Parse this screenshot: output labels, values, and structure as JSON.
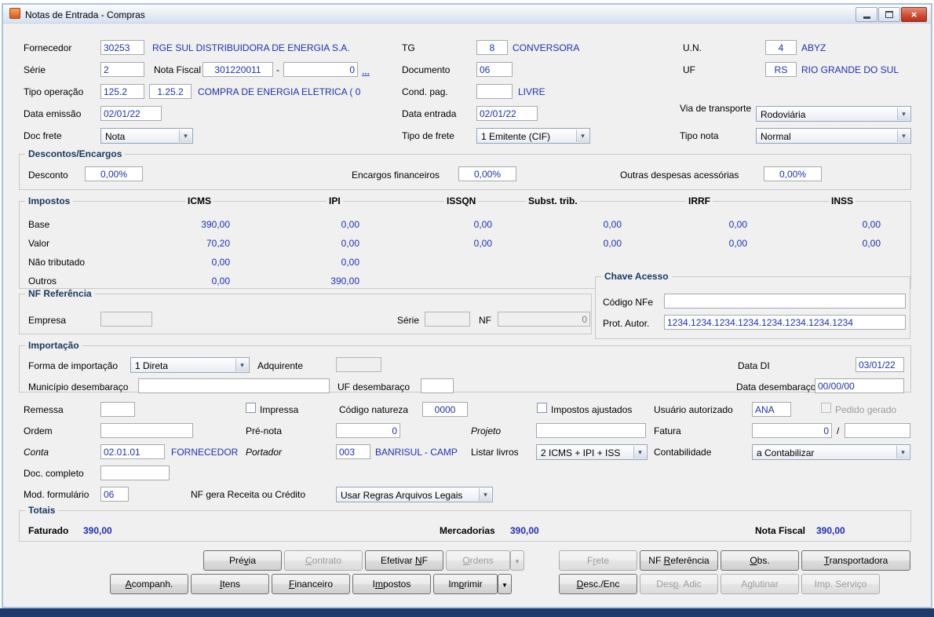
{
  "window": {
    "title": "Notas de Entrada - Compras"
  },
  "icons": {
    "combo_arrow": "▾",
    "dropdown_arrow": "▼",
    "close": "×"
  },
  "fields": {
    "fornecedor": {
      "label": "Fornecedor",
      "code": "30253",
      "desc": "RGE SUL DISTRIBUIDORA DE ENERGIA S.A."
    },
    "tg": {
      "label": "TG",
      "code": "8",
      "desc": "CONVERSORA"
    },
    "un": {
      "label": "U.N.",
      "code": "4",
      "desc": "ABYZ"
    },
    "serie": {
      "label": "Série",
      "value": "2"
    },
    "nota_fiscal": {
      "label": "Nota Fiscal",
      "numero": "301220011",
      "dash": "-",
      "serie_sufixo": "0",
      "browse": "..."
    },
    "documento": {
      "label": "Documento",
      "value": "06"
    },
    "uf": {
      "label": "UF",
      "code": "RS",
      "desc": "RIO GRANDE DO SUL"
    },
    "tipo_operacao": {
      "label": "Tipo operação",
      "code": "125.2",
      "natureza": "1.25.2",
      "desc": "COMPRA DE ENERGIA ELETRICA ( 0"
    },
    "cond_pag": {
      "label": "Cond. pag.",
      "value": "",
      "desc": "LIVRE"
    },
    "data_emissao": {
      "label": "Data emissão",
      "value": "02/01/22"
    },
    "data_entrada": {
      "label": "Data entrada",
      "value": "02/01/22"
    },
    "via_transporte": {
      "label": "Via de transporte",
      "value": "Rodoviária"
    },
    "doc_frete": {
      "label": "Doc frete",
      "value": "Nota"
    },
    "tipo_frete": {
      "label": "Tipo de frete",
      "value": "1 Emitente (CIF)"
    },
    "tipo_nota": {
      "label": "Tipo nota",
      "value": "Normal"
    }
  },
  "descontos_encargos": {
    "title": "Descontos/Encargos",
    "desconto": {
      "label": "Desconto",
      "value": "0,00%"
    },
    "encargos_financeiros": {
      "label": "Encargos financeiros",
      "value": "0,00%"
    },
    "outras_despesas": {
      "label": "Outras despesas acessórias",
      "value": "0,00%"
    }
  },
  "impostos": {
    "title": "Impostos",
    "columns": [
      "ICMS",
      "IPI",
      "ISSQN",
      "Subst. trib.",
      "IRRF",
      "INSS"
    ],
    "rows": [
      {
        "label": "Base",
        "values": [
          "390,00",
          "0,00",
          "0,00",
          "0,00",
          "0,00",
          "0,00"
        ]
      },
      {
        "label": "Valor",
        "values": [
          "70,20",
          "0,00",
          "0,00",
          "0,00",
          "0,00",
          "0,00"
        ]
      },
      {
        "label": "Não tributado",
        "values": [
          "0,00",
          "0,00",
          "",
          "",
          "",
          ""
        ]
      },
      {
        "label": "Outros",
        "values": [
          "0,00",
          "390,00",
          "",
          "",
          "",
          ""
        ]
      }
    ]
  },
  "nf_referencia": {
    "title": "NF Referência",
    "empresa": {
      "label": "Empresa",
      "value": ""
    },
    "serie": {
      "label": "Série",
      "value": ""
    },
    "nf": {
      "label": "NF",
      "value": "0"
    }
  },
  "chave_acesso": {
    "title": "Chave Acesso",
    "codigo_nfe": {
      "label": "Código NFe",
      "value": ""
    },
    "prot_autor": {
      "label": "Prot. Autor.",
      "value": "1234.1234.1234.1234.1234.1234.1234.1234"
    }
  },
  "importacao": {
    "title": "Importação",
    "forma": {
      "label": "Forma de importação",
      "value": "1 Direta"
    },
    "adquirente": {
      "label": "Adquirente",
      "value": ""
    },
    "data_di": {
      "label": "Data DI",
      "value": "03/01/22"
    },
    "municipio": {
      "label": "Município desembaraço",
      "value": ""
    },
    "uf_desembaraco": {
      "label": "UF desembaraço",
      "value": ""
    },
    "data_desembaraco": {
      "label": "Data desembaraço",
      "value": "00/00/00"
    }
  },
  "outros_campos": {
    "remessa": {
      "label": "Remessa",
      "value": ""
    },
    "impressa": {
      "label": "Impressa",
      "checked": false
    },
    "codigo_natureza": {
      "label": "Código natureza",
      "value": "0000"
    },
    "impostos_ajustados": {
      "label": "Impostos ajustados",
      "checked": false
    },
    "usuario_autorizado": {
      "label": "Usuário autorizado",
      "value": "ANA"
    },
    "pedido_gerado": {
      "label": "Pedido gerado",
      "checked": false
    },
    "ordem": {
      "label": "Ordem",
      "value": ""
    },
    "pre_nota": {
      "label": "Pré-nota",
      "value": "0"
    },
    "projeto": {
      "label": "Projeto",
      "value": ""
    },
    "fatura": {
      "label": "Fatura",
      "value": "0",
      "separator": "/",
      "value2": ""
    },
    "conta": {
      "label": "Conta",
      "value": "02.01.01",
      "desc": "FORNECEDOR"
    },
    "portador": {
      "label": "Portador",
      "value": "003",
      "desc": "BANRISUL - CAMP"
    },
    "listar_livros": {
      "label": "Listar livros",
      "value": "2 ICMS + IPI + ISS"
    },
    "contabilidade": {
      "label": "Contabilidade",
      "value": "a Contabilizar"
    },
    "doc_completo": {
      "label": "Doc. completo",
      "value": ""
    },
    "mod_formulario": {
      "label": "Mod. formulário",
      "value": "06"
    },
    "nf_gera": {
      "label": "NF gera Receita ou Crédito",
      "value": "Usar Regras Arquivos Legais"
    }
  },
  "totais": {
    "title": "Totais",
    "faturado": {
      "label": "Faturado",
      "value": "390,00"
    },
    "mercadorias": {
      "label": "Mercadorias",
      "value": "390,00"
    },
    "nota_fiscal": {
      "label": "Nota Fiscal",
      "value": "390,00"
    }
  },
  "buttons": {
    "row1": [
      {
        "label": "Prévia",
        "accel": 3,
        "enabled": true
      },
      {
        "label": "Contrato",
        "accel": 0,
        "enabled": false
      },
      {
        "label": "Efetivar NF",
        "accel": 9,
        "enabled": true
      },
      {
        "label": "Ordens",
        "accel": 0,
        "enabled": false,
        "arrow": true
      },
      {
        "label": "Frete",
        "accel": 1,
        "enabled": false
      },
      {
        "label": "NF Referência",
        "accel": 3,
        "enabled": true
      },
      {
        "label": "Obs.",
        "accel": 0,
        "enabled": true
      },
      {
        "label": "Transportadora",
        "accel": 0,
        "enabled": true
      }
    ],
    "row2": [
      {
        "label": "Acompanh.",
        "accel": 0,
        "enabled": true
      },
      {
        "label": "Itens",
        "accel": 0,
        "enabled": true
      },
      {
        "label": "Financeiro",
        "accel": 0,
        "enabled": true
      },
      {
        "label": "Impostos",
        "accel": 1,
        "enabled": true
      },
      {
        "label": "Imprimir",
        "accel": 2,
        "enabled": true,
        "arrow": true
      },
      {
        "label": "Desc./Enc",
        "accel": 0,
        "enabled": true
      },
      {
        "label": "Desp. Adic",
        "accel": 3,
        "enabled": false
      },
      {
        "label": "Aglutinar",
        "accel": 1,
        "enabled": false
      },
      {
        "label": "Imp. Serviço",
        "accel": null,
        "enabled": false
      }
    ]
  }
}
